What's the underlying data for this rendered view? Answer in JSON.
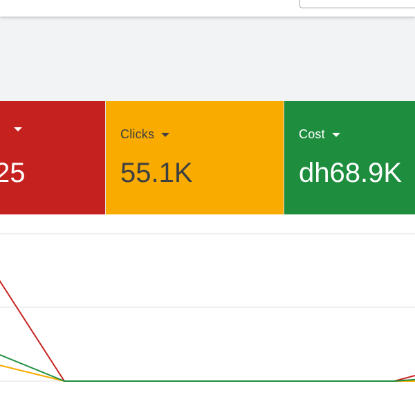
{
  "scorecards": [
    {
      "label": "",
      "value": "25",
      "color": "#c5221f"
    },
    {
      "label": "Clicks",
      "value": "55.1K",
      "color": "#f9ab00"
    },
    {
      "label": "Cost",
      "value": "dh68.9K",
      "color": "#1e8e3e"
    }
  ],
  "chart_data": {
    "type": "line",
    "grid": true,
    "series": [
      {
        "color": "#c5221f",
        "values": [
          0.95,
          0.0,
          0.0,
          0.0,
          0.0,
          0.0,
          0.0,
          0.07
        ]
      },
      {
        "color": "#f9ab00",
        "values": [
          0.15,
          0.0,
          0.0,
          0.0,
          0.0,
          0.0,
          0.0,
          0.0
        ]
      },
      {
        "color": "#1e8e3e",
        "values": [
          0.25,
          0.0,
          0.0,
          0.0,
          0.0,
          0.0,
          0.0,
          0.02
        ]
      }
    ]
  }
}
